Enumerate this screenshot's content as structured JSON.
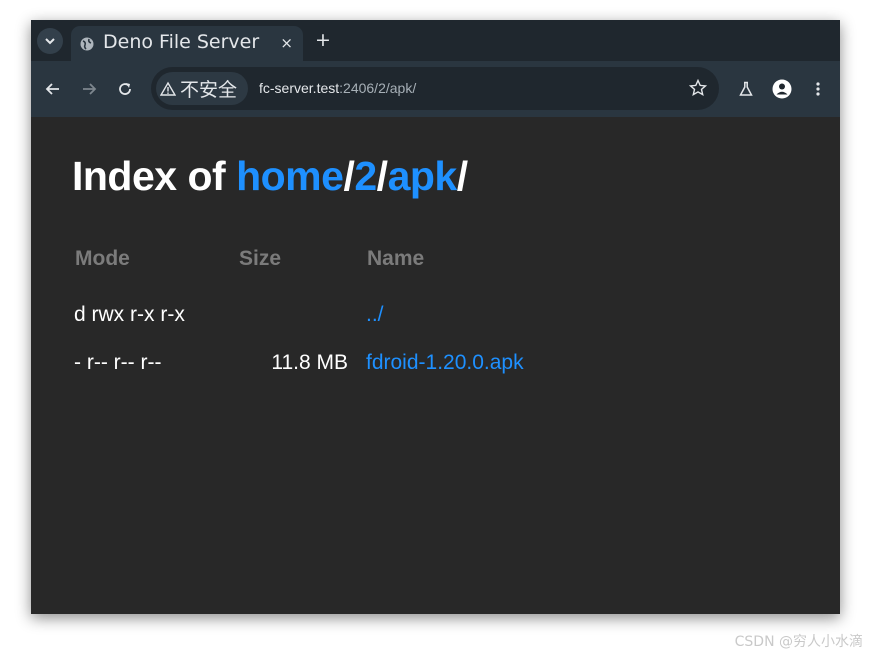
{
  "tab": {
    "title": "Deno File Server",
    "close": "×",
    "new_tab": "+"
  },
  "toolbar": {
    "security_label": "不安全",
    "url_host": "fc-server.test",
    "url_path": ":2406/2/apk/"
  },
  "page": {
    "heading_prefix": "Index of ",
    "breadcrumb": [
      {
        "label": "home",
        "sep": "/"
      },
      {
        "label": "2",
        "sep": "/"
      },
      {
        "label": "apk",
        "sep": "/"
      }
    ],
    "columns": {
      "mode": "Mode",
      "size": "Size",
      "name": "Name"
    },
    "rows": [
      {
        "mode": "d rwx r-x r-x",
        "size": "",
        "name": "../"
      },
      {
        "mode": "- r-- r-- r--",
        "size": "11.8 MB",
        "name": "fdroid-1.20.0.apk"
      }
    ]
  },
  "watermark": "CSDN @穷人小水滴",
  "colors": {
    "link": "#1e90ff",
    "page_bg": "#282828",
    "toolbar_bg": "#2a3640",
    "header_text": "#7b7b7b"
  }
}
